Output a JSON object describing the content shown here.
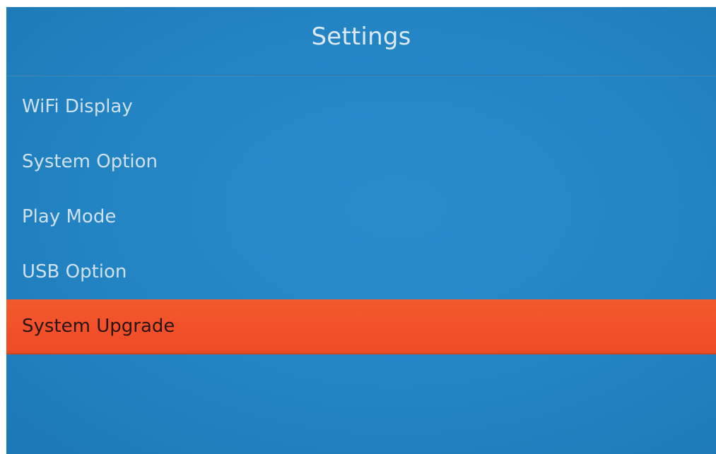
{
  "header": {
    "title": "Settings"
  },
  "menu": {
    "items": [
      {
        "label": "WiFi Display",
        "selected": false
      },
      {
        "label": "System Option",
        "selected": false
      },
      {
        "label": "Play Mode",
        "selected": false
      },
      {
        "label": "USB Option",
        "selected": false
      },
      {
        "label": "System Upgrade",
        "selected": true
      }
    ]
  },
  "colors": {
    "background": "#2384c4",
    "highlight": "#f3512a",
    "text": "#cfe0ef",
    "selected_text": "#2a1410"
  }
}
